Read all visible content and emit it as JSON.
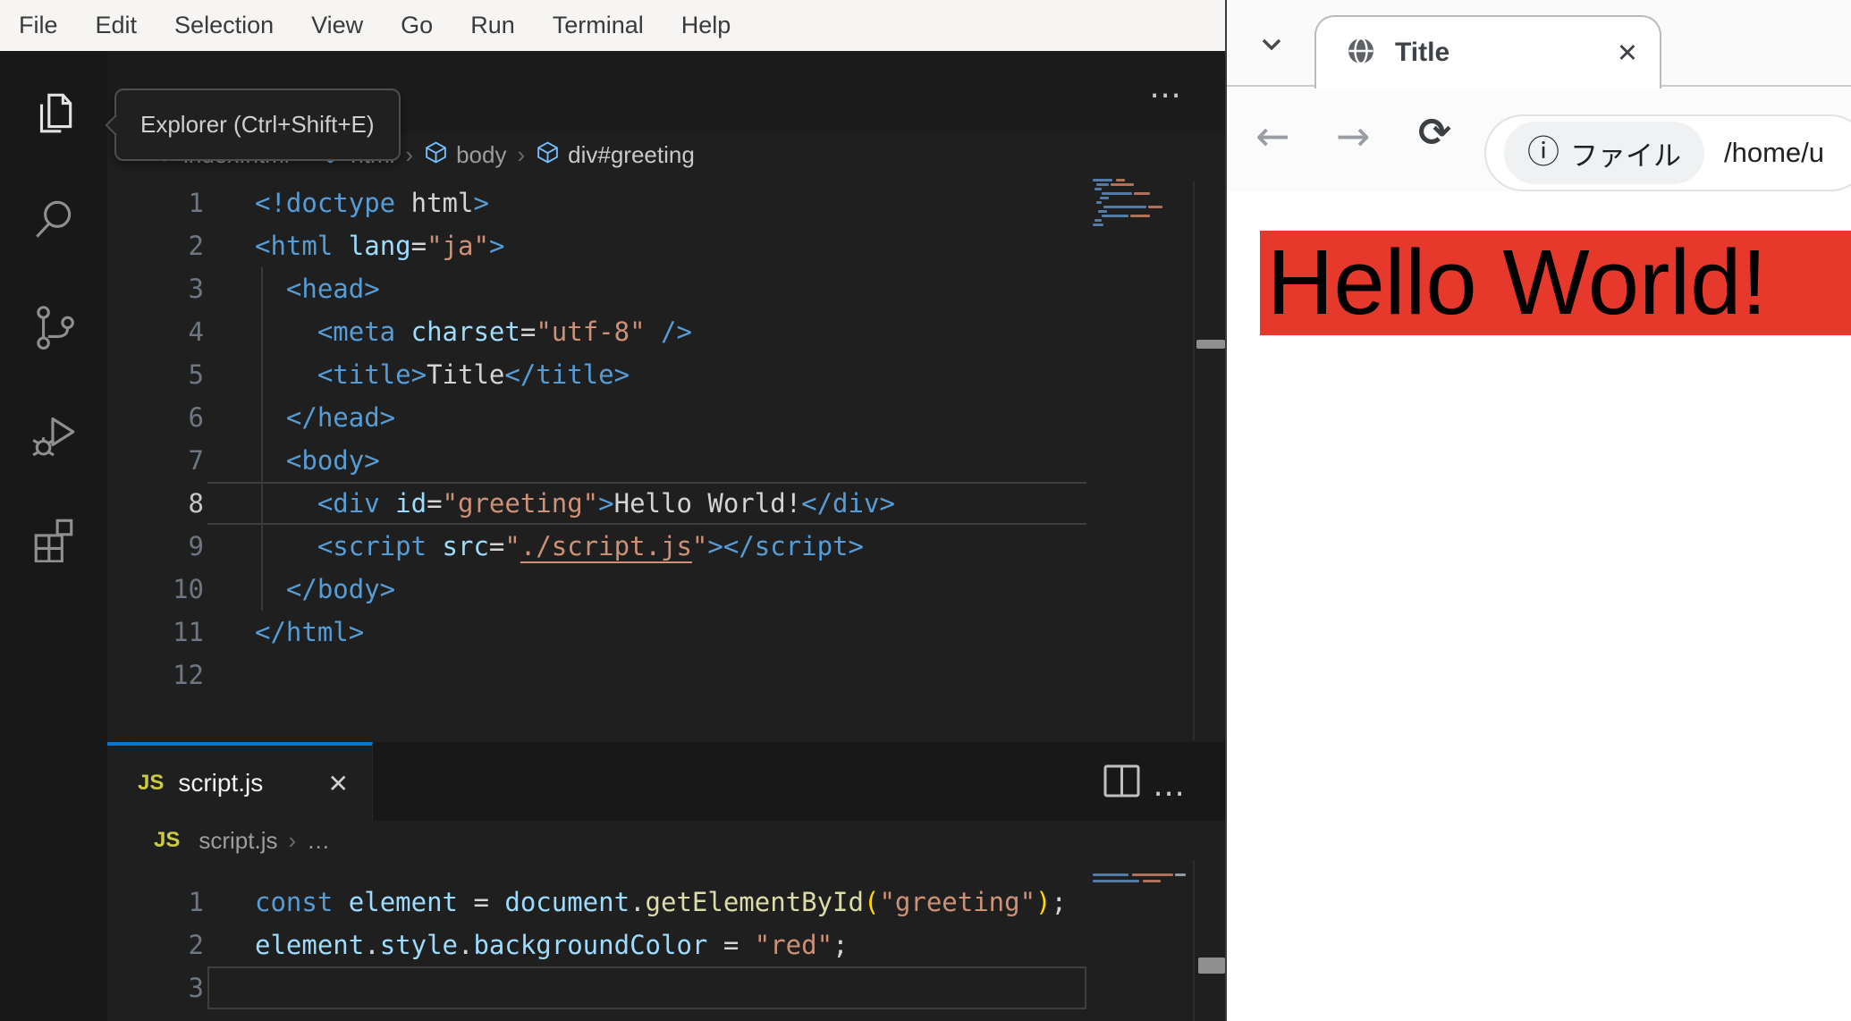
{
  "vscode": {
    "menu_items": [
      "File",
      "Edit",
      "Selection",
      "View",
      "Go",
      "Run",
      "Terminal",
      "Help"
    ],
    "activity_tooltip": "Explorer (Ctrl+Shift+E)",
    "activity_items": [
      "explorer",
      "search",
      "source-control",
      "run-and-debug",
      "extensions"
    ],
    "editor_html": {
      "more_label": "⋯",
      "breadcrumb": {
        "code_icon": "<>",
        "file": "index.html",
        "sep": "›",
        "segments": [
          "html",
          "body",
          "div#greeting"
        ]
      },
      "active_line": 8,
      "lines": [
        [
          [
            "tag",
            "<!doctype "
          ],
          [
            "txt",
            "html"
          ],
          [
            "tag",
            ">"
          ]
        ],
        [
          [
            "tag",
            "<html"
          ],
          [
            "attr",
            " lang"
          ],
          [
            "op",
            "="
          ],
          [
            "str",
            "\"ja\""
          ],
          [
            "tag",
            ">"
          ]
        ],
        [
          [
            "txt",
            "  "
          ],
          [
            "tag",
            "<head>"
          ]
        ],
        [
          [
            "txt",
            "    "
          ],
          [
            "tag",
            "<meta"
          ],
          [
            "attr",
            " charset"
          ],
          [
            "op",
            "="
          ],
          [
            "str",
            "\"utf-8\""
          ],
          [
            "tag",
            " />"
          ]
        ],
        [
          [
            "txt",
            "    "
          ],
          [
            "tag",
            "<title>"
          ],
          [
            "txt",
            "Title"
          ],
          [
            "tag",
            "</title>"
          ]
        ],
        [
          [
            "txt",
            "  "
          ],
          [
            "tag",
            "</head>"
          ]
        ],
        [
          [
            "txt",
            "  "
          ],
          [
            "tag",
            "<body>"
          ]
        ],
        [
          [
            "txt",
            "    "
          ],
          [
            "tag",
            "<div"
          ],
          [
            "attr",
            " id"
          ],
          [
            "op",
            "="
          ],
          [
            "str",
            "\"greeting\""
          ],
          [
            "tag",
            ">"
          ],
          [
            "txt",
            "Hello World!"
          ],
          [
            "tag",
            "</div>"
          ]
        ],
        [
          [
            "txt",
            "    "
          ],
          [
            "tag",
            "<script"
          ],
          [
            "attr",
            " src"
          ],
          [
            "op",
            "="
          ],
          [
            "str",
            "\""
          ],
          [
            "link",
            "./script.js"
          ],
          [
            "str",
            "\""
          ],
          [
            "tag",
            "></script>"
          ]
        ],
        [
          [
            "txt",
            "  "
          ],
          [
            "tag",
            "</body>"
          ]
        ],
        [
          [
            "tag",
            "</html>"
          ]
        ],
        []
      ]
    },
    "editor_js": {
      "tab": {
        "icon_label": "JS",
        "label": "script.js",
        "close_label": "✕"
      },
      "more_label": "⋯",
      "breadcrumb": {
        "icon_label": "JS",
        "file": "script.js",
        "sep": "›",
        "ellipsis": "…"
      },
      "active_line": 3,
      "lines": [
        [
          [
            "kw",
            "const"
          ],
          [
            "var",
            " element "
          ],
          [
            "op",
            "= "
          ],
          [
            "var",
            "document"
          ],
          [
            "op",
            "."
          ],
          [
            "fn",
            "getElementById"
          ],
          [
            "par",
            "("
          ],
          [
            "str",
            "\"greeting\""
          ],
          [
            "par",
            ")"
          ],
          [
            "op",
            ";"
          ]
        ],
        [
          [
            "var",
            "element"
          ],
          [
            "op",
            "."
          ],
          [
            "var",
            "style"
          ],
          [
            "op",
            "."
          ],
          [
            "var",
            "backgroundColor"
          ],
          [
            "op",
            " = "
          ],
          [
            "str",
            "\"red\""
          ],
          [
            "op",
            ";"
          ]
        ],
        []
      ]
    },
    "colors": {
      "tab_accent": "#0078d4",
      "js_icon": "#cbcb41"
    }
  },
  "browser": {
    "tab": {
      "title": "Title",
      "close_label": "✕"
    },
    "toolbar": {
      "back_glyph": "←",
      "forward_glyph": "→",
      "reload_glyph": "⟳",
      "chip_info_glyph": "ⓘ",
      "chip_label": "ファイル",
      "url_text": "/home/u"
    },
    "page": {
      "greeting_text": "Hello World!",
      "greeting_bg": "#e6392b"
    }
  }
}
